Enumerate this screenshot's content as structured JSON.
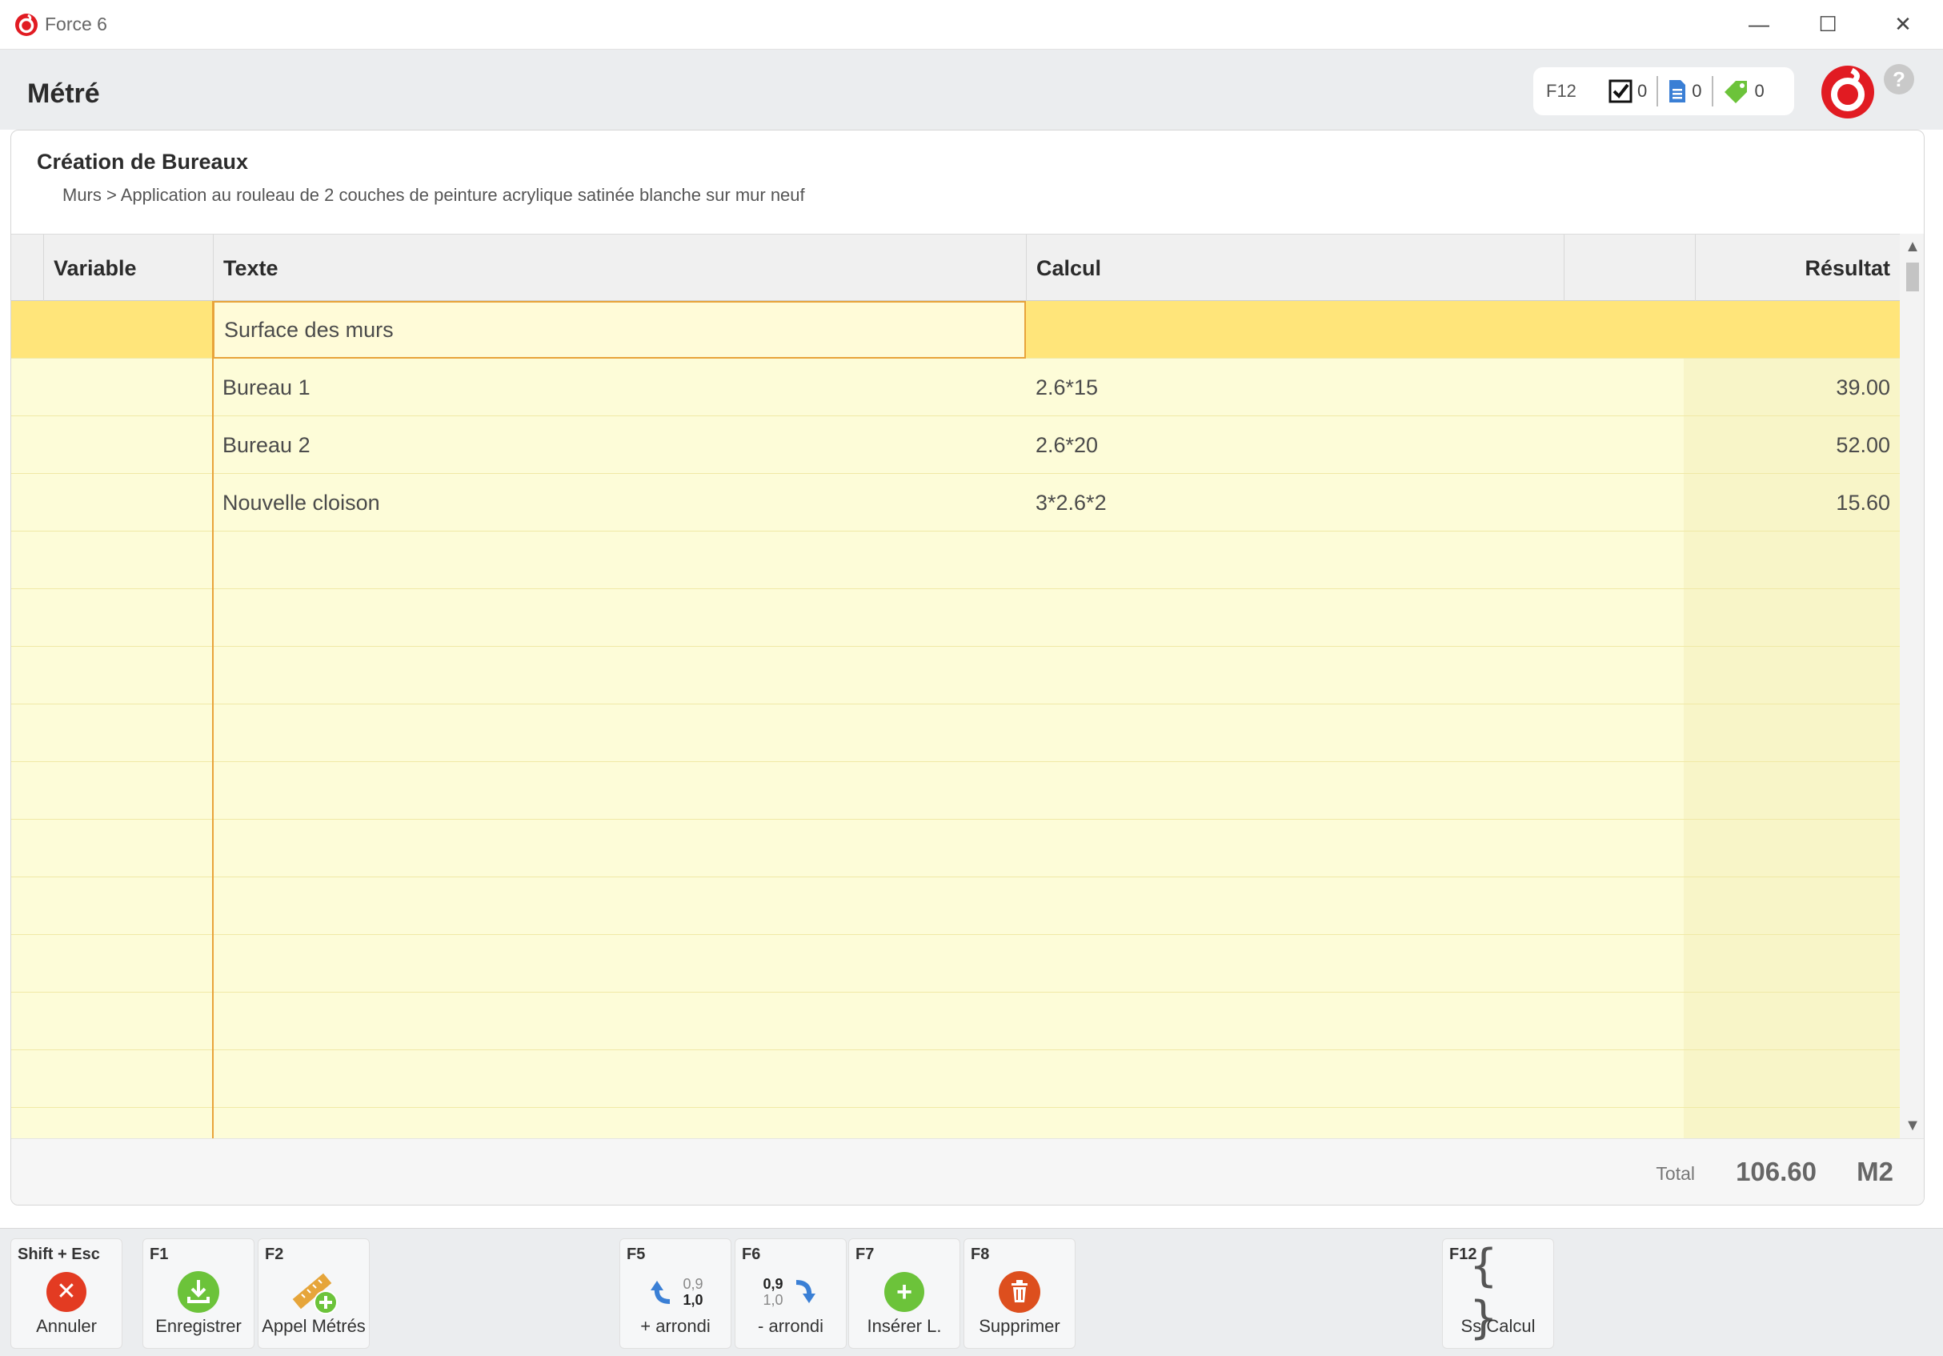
{
  "window": {
    "title": "Force 6",
    "minimize_glyph": "—",
    "maximize_glyph": "☐",
    "close_glyph": "✕"
  },
  "header": {
    "title": "Métré",
    "status": {
      "f12_label": "F12",
      "tasks_count": "0",
      "docs_count": "0",
      "tags_count": "0"
    },
    "help_glyph": "?"
  },
  "card": {
    "section_title": "Création de Bureaux",
    "breadcrumb": "Murs > Application au rouleau de 2 couches de peinture acrylique satinée blanche sur mur neuf"
  },
  "grid": {
    "columns": {
      "variable": "Variable",
      "texte": "Texte",
      "calcul": "Calcul",
      "extra": "",
      "resultat": "Résultat"
    },
    "rows": [
      {
        "variable": "",
        "texte": "Surface des murs",
        "calcul": "",
        "resultat": ""
      },
      {
        "variable": "",
        "texte": "Bureau 1",
        "calcul": "2.6*15",
        "resultat": "39.00"
      },
      {
        "variable": "",
        "texte": "Bureau 2",
        "calcul": "2.6*20",
        "resultat": "52.00"
      },
      {
        "variable": "",
        "texte": "Nouvelle cloison",
        "calcul": "3*2.6*2",
        "resultat": "15.60"
      },
      {
        "variable": "",
        "texte": "",
        "calcul": "",
        "resultat": ""
      },
      {
        "variable": "",
        "texte": "",
        "calcul": "",
        "resultat": ""
      },
      {
        "variable": "",
        "texte": "",
        "calcul": "",
        "resultat": ""
      },
      {
        "variable": "",
        "texte": "",
        "calcul": "",
        "resultat": ""
      },
      {
        "variable": "",
        "texte": "",
        "calcul": "",
        "resultat": ""
      },
      {
        "variable": "",
        "texte": "",
        "calcul": "",
        "resultat": ""
      },
      {
        "variable": "",
        "texte": "",
        "calcul": "",
        "resultat": ""
      },
      {
        "variable": "",
        "texte": "",
        "calcul": "",
        "resultat": ""
      },
      {
        "variable": "",
        "texte": "",
        "calcul": "",
        "resultat": ""
      },
      {
        "variable": "",
        "texte": "",
        "calcul": "",
        "resultat": ""
      },
      {
        "variable": "",
        "texte": "",
        "calcul": "",
        "resultat": ""
      }
    ]
  },
  "totals": {
    "label": "Total",
    "value": "106.60",
    "unit": "M2"
  },
  "toolbar": {
    "annuler": {
      "key": "Shift + Esc",
      "label": "Annuler"
    },
    "enregistrer": {
      "key": "F1",
      "label": "Enregistrer"
    },
    "appel": {
      "key": "F2",
      "label": "Appel Métrés"
    },
    "plus_arrondi": {
      "key": "F5",
      "label": "+ arrondi",
      "top": "0,9",
      "bottom": "1,0"
    },
    "moins_arrondi": {
      "key": "F6",
      "label": "- arrondi",
      "top": "0,9",
      "bottom": "1,0"
    },
    "inserer": {
      "key": "F7",
      "label": "Insérer L."
    },
    "supprimer": {
      "key": "F8",
      "label": "Supprimer"
    },
    "ss_calcul": {
      "key": "F12",
      "label": "Ss Calcul"
    }
  },
  "colors": {
    "brand_red": "#e11b22",
    "selected_row": "#ffe57a",
    "grid_body": "#fdfcd8",
    "focus_border": "#e8a33a",
    "green": "#6cc33a",
    "delete_red": "#dd4f1e"
  }
}
